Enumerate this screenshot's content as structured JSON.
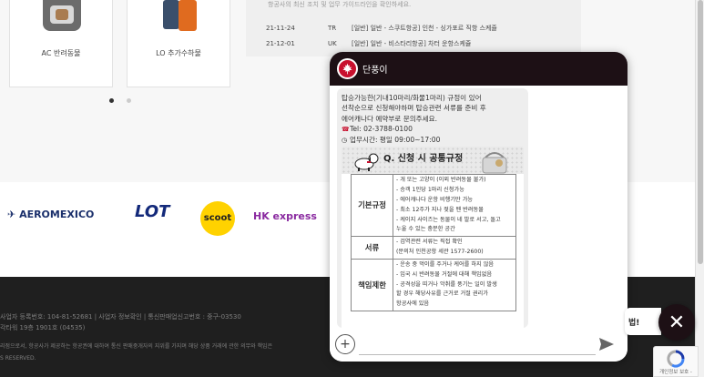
{
  "carousel": {
    "cards": [
      {
        "label": "AC 반려동물",
        "icon": "pet-carrier-icon"
      },
      {
        "label": "LO 추가수하물",
        "icon": "luggage-icon"
      }
    ]
  },
  "notice": {
    "intro": "항공사의 최신 조치 및 업무 가이드라인을 확인하세요.",
    "rows": [
      {
        "date": "21-11-24",
        "code": "TR",
        "text": "[일반] 일반 - 스쿠트항공] 인천 - 싱가포르 직항 스케쥴"
      },
      {
        "date": "21-12-01",
        "code": "UK",
        "text": "[일반] 일반 - 비스타리항공] 차터 운항스케쥴"
      }
    ]
  },
  "partners": {
    "logos": [
      "AEROMEXICO",
      "LOT",
      "scoot",
      "HK express"
    ]
  },
  "footer": {
    "line1": "사업자 등록번호: 104-81-52681  |  사업자 정보확인  |  통신판매업신고번호 : 중구-03530",
    "line2": "각타워 19층 1901호 (04535)",
    "line3": "리점으로서, 항공사가 제공하는 항공권에 대하여 통신 판매중개자의 지위를 가지며 해당 상품 거래에 관한 의무와 책임은",
    "line4": "S RESERVED."
  },
  "chat": {
    "title": "단풍이",
    "message_lines": [
      "탑승가능한(기내10마리/화물1마리) 규정이 있어",
      "선착순으로 신청해야하며 탑승관련 서류를 준비 후",
      "에어캐나다 예약부로 문의주세요."
    ],
    "phone": "Tel: 02-3788-0100",
    "hours": "업무시간: 평일 09:00~17:00",
    "card": {
      "title": "Q. 신청 시 공통규정",
      "sections": [
        {
          "category": "기본규정",
          "items": [
            "- 개 또는 고양이 (이외 반려동물 불가)",
            "- 승객 1인당 1마리 신청가능",
            "- 에어캐나다 운항 비행기만 가능",
            "- 최소 12주가 지나 젖을 뗀 반려동물",
            "- 케이지 사이즈는 동물이 네 발로 서고, 돌고",
            "  누울 수 있는 충분한 공간"
          ]
        },
        {
          "category": "서류",
          "items": [
            "- 검역관련 서류는 직접 확인",
            "  (문의처 인천공항 세관 1577-2600)"
          ]
        },
        {
          "category": "책임제한",
          "items": [
            "- 운송 중 먹이를 주거나 케어를 하지 않음",
            "- 입국 시 반려동물 거절에 대해 책임없음",
            "- 공격성을 띠거나 악취를 풍기는 일이 발생",
            "  할 경우 해당사유를 근거로 거절 권리가",
            "  항공사에 있음"
          ]
        }
      ]
    },
    "input_placeholder": ""
  },
  "side_pill_text": "법!",
  "recaptcha_text": "개인정보 보호 -",
  "colors": {
    "brand_red": "#c8102e",
    "header_dark": "#1d1015",
    "footer_bg": "#1f1f1f"
  }
}
